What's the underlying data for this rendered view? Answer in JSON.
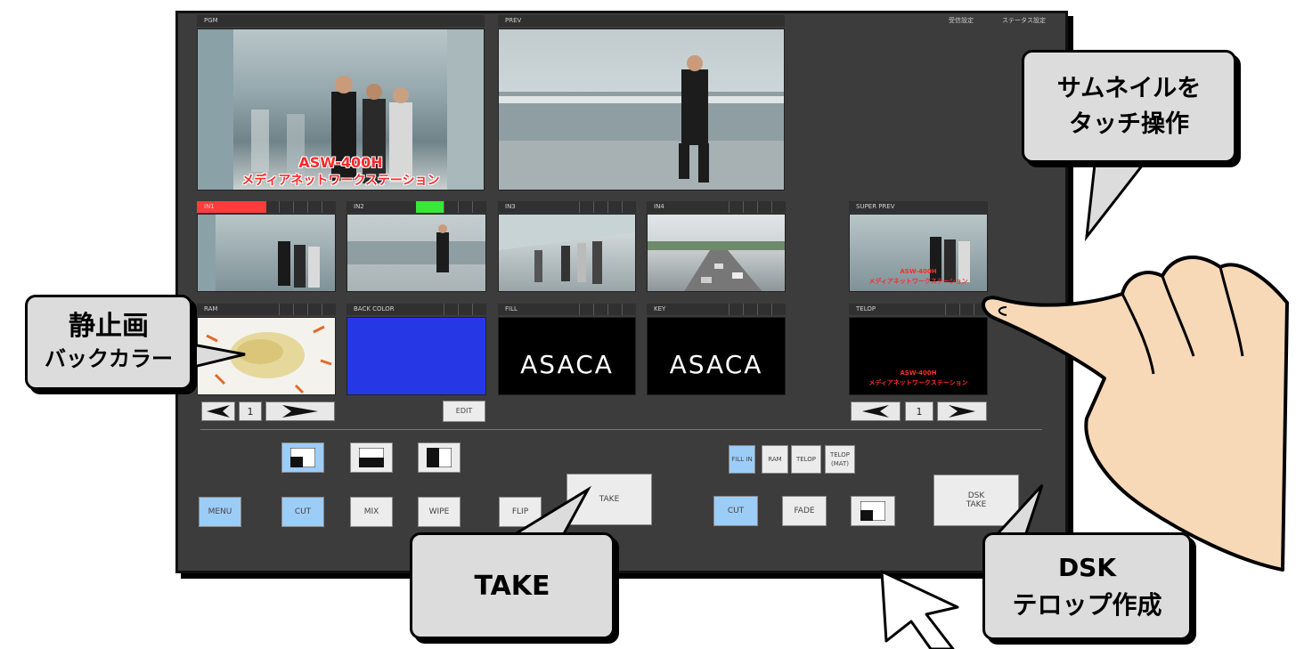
{
  "header": {
    "status_left": "受信設定",
    "status_right": "ステータス設定"
  },
  "monitors": {
    "pgm": {
      "label": "PGM",
      "caption_line1": "ASW-400H",
      "caption_line2": "メディアネットワークステーション"
    },
    "prev": {
      "label": "PREV"
    }
  },
  "inputs": [
    {
      "label": "IN1",
      "tally": "red"
    },
    {
      "label": "IN2",
      "tally": "green"
    },
    {
      "label": "IN3",
      "tally": ""
    },
    {
      "label": "IN4",
      "tally": ""
    }
  ],
  "sources": [
    {
      "label": "RAM"
    },
    {
      "label": "BACK COLOR"
    },
    {
      "label": "FILL",
      "logo": "ASACA"
    },
    {
      "label": "KEY",
      "logo": "ASACA"
    }
  ],
  "super": {
    "prev_label": "SUPER PREV",
    "prev_caption_line1": "ASW-400H",
    "prev_caption_line2": "メディアネットワークステーション",
    "telop_label": "TELOP",
    "telop_line1": "ASW-400H",
    "telop_line2": "メディアネットワークステーション"
  },
  "ram_pager": {
    "value": "1"
  },
  "telop_pager": {
    "value": "1"
  },
  "edit_button": "EDIT",
  "controls": {
    "menu": "MENU",
    "cut": "CUT",
    "mix": "MIX",
    "wipe": "WIPE",
    "flip": "FLIP",
    "take": "TAKE",
    "fill_in": "FILL IN",
    "ram": "RAM",
    "telop": "TELOP",
    "telop_mat_line1": "TELOP",
    "telop_mat_line2": "(MAT)",
    "dsk_cut": "CUT",
    "fade": "FADE",
    "dsk_take_line1": "DSK",
    "dsk_take_line2": "TAKE"
  },
  "callouts": {
    "thumbnail_line1": "サムネイルを",
    "thumbnail_line2": "タッチ操作",
    "still_line1": "静止画",
    "still_line2": "バックカラー",
    "take": "TAKE",
    "dsk_line1": "DSK",
    "dsk_line2": "テロップ作成"
  },
  "colors": {
    "panel": "#3c3c3c",
    "active_button": "#9ccdf7",
    "tally_red": "#ff3b3b",
    "tally_green": "#39e639",
    "back_color": "#2638e6",
    "caption_red": "#ff2a2a"
  },
  "icons": [
    "wipe-box-icon",
    "wipe-horizontal-icon",
    "wipe-vertical-icon",
    "left-arrow-icon",
    "right-arrow-icon",
    "hand-icon",
    "cursor-icon"
  ]
}
